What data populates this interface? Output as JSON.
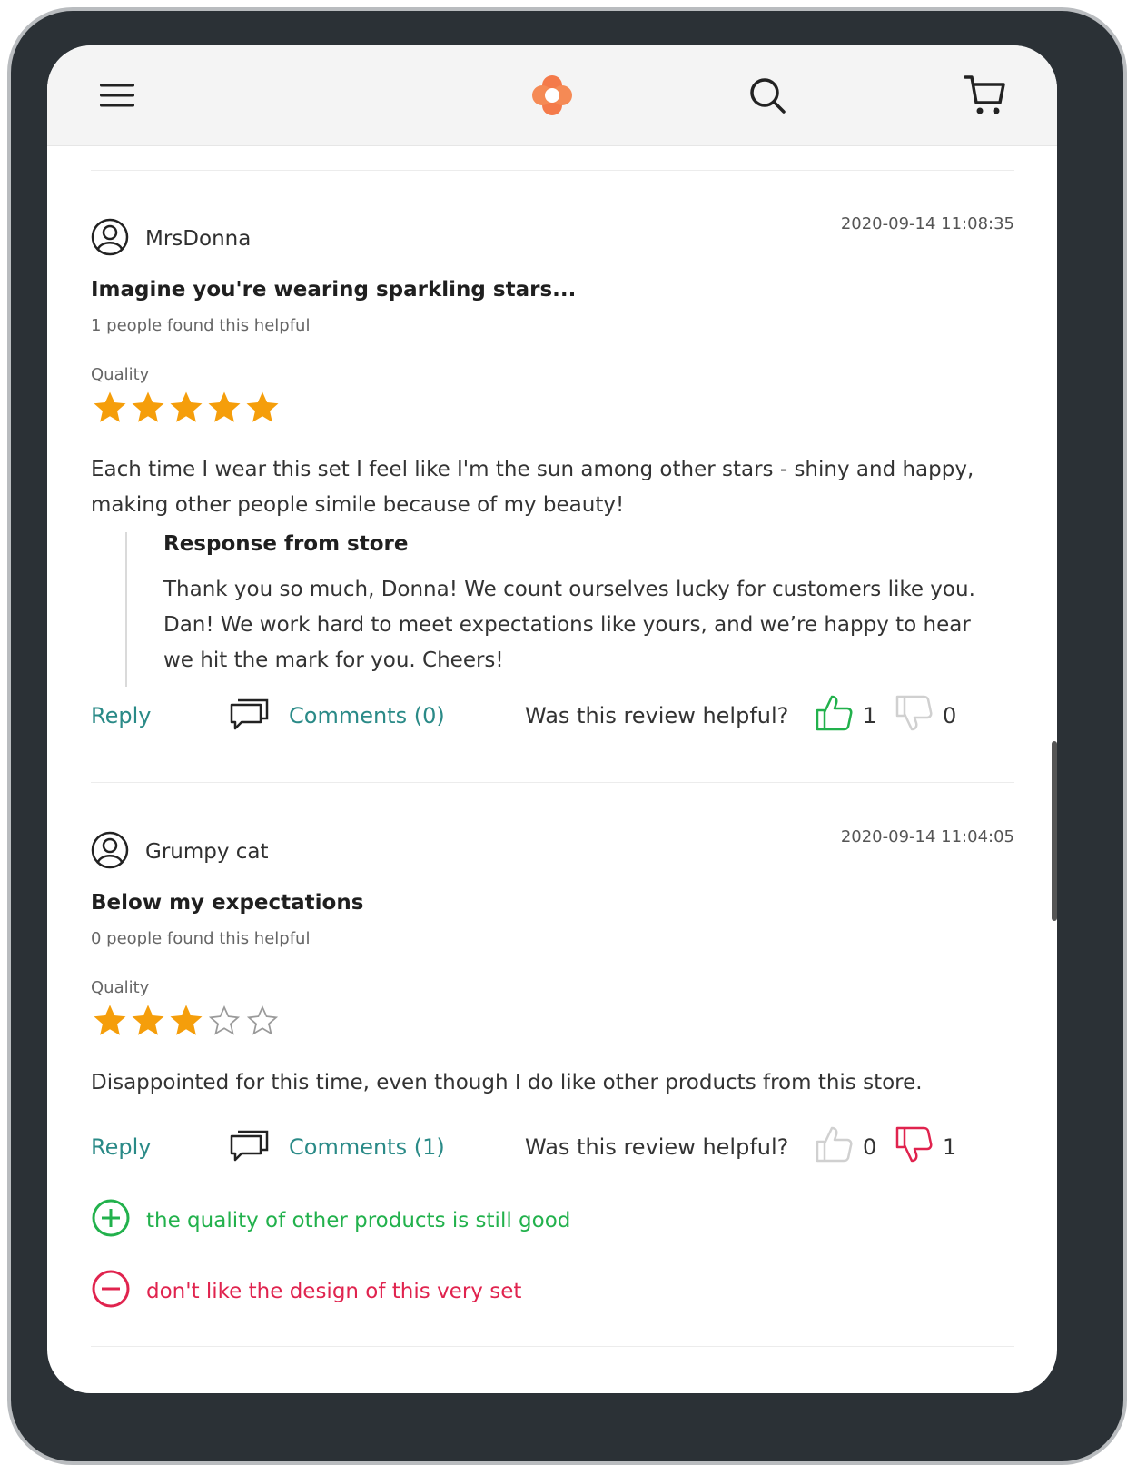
{
  "header": {
    "menu_icon": "hamburger-menu-icon",
    "logo_icon": "brand-logo-icon",
    "search_icon": "search-icon",
    "cart_icon": "cart-icon"
  },
  "colors": {
    "accent": "#2a8a87",
    "star": "#f59e0b",
    "positive": "#22b14c",
    "negative": "#e0234e",
    "logo": "#f47a4a"
  },
  "reviews": [
    {
      "author": "MrsDonna",
      "date": "2020-09-14 11:08:35",
      "title": "Imagine you're wearing sparkling stars...",
      "helpful_text": "1 people found this helpful",
      "quality_label": "Quality",
      "rating": 5,
      "body": "Each time I wear this set I feel like I'm the sun among other stars - shiny and happy, making other people simile because of my beauty!",
      "response": {
        "title": "Response from store",
        "text": "Thank you so much, Donna! We count ourselves lucky for customers like you. Dan! We work hard to meet expectations like yours, and we’re happy to hear we hit the mark for you. Cheers!"
      },
      "reply_label": "Reply",
      "comments_label": "Comments (0)",
      "helpful_question": "Was this review helpful?",
      "likes": "1",
      "dislikes": "0"
    },
    {
      "author": "Grumpy cat",
      "date": "2020-09-14 11:04:05",
      "title": "Below my expectations",
      "helpful_text": "0 people found this helpful",
      "quality_label": "Quality",
      "rating": 3,
      "body": "Disappointed for this time, even though I do like other products from this store.",
      "reply_label": "Reply",
      "comments_label": "Comments (1)",
      "helpful_question": "Was this review helpful?",
      "likes": "0",
      "dislikes": "1",
      "pros": "the quality of other products is still good",
      "cons": "don't like the design of this very set"
    }
  ]
}
